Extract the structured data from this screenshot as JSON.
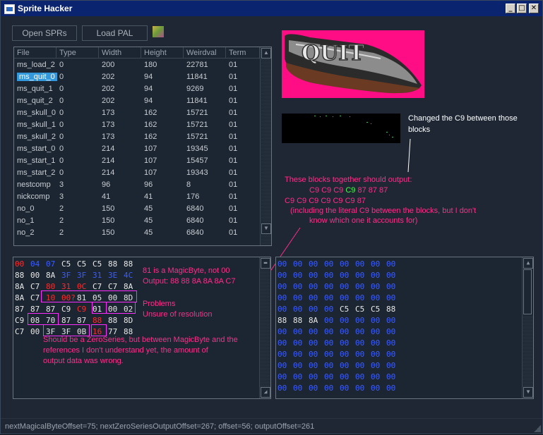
{
  "window": {
    "title": "Sprite Hacker",
    "min_glyph": "_",
    "max_glyph": "□",
    "close_glyph": "✕"
  },
  "toolbar": {
    "open_label": "Open SPRs",
    "load_label": "Load PAL",
    "icon": "palette-icon"
  },
  "list": {
    "columns": [
      "File",
      "Type",
      "Width",
      "Height",
      "Weirdval",
      "Term"
    ],
    "rows": [
      [
        "ms_load_2",
        "0",
        "200",
        "180",
        "22781",
        "01"
      ],
      [
        "ms_quit_0",
        "0",
        "202",
        "94",
        "11841",
        "01"
      ],
      [
        "ms_quit_1",
        "0",
        "202",
        "94",
        "9269",
        "01"
      ],
      [
        "ms_quit_2",
        "0",
        "202",
        "94",
        "11841",
        "01"
      ],
      [
        "ms_skull_0",
        "0",
        "173",
        "162",
        "15721",
        "01"
      ],
      [
        "ms_skull_1",
        "0",
        "173",
        "162",
        "15721",
        "01"
      ],
      [
        "ms_skull_2",
        "0",
        "173",
        "162",
        "15721",
        "01"
      ],
      [
        "ms_start_0",
        "0",
        "214",
        "107",
        "19345",
        "01"
      ],
      [
        "ms_start_1",
        "0",
        "214",
        "107",
        "15457",
        "01"
      ],
      [
        "ms_start_2",
        "0",
        "214",
        "107",
        "19343",
        "01"
      ],
      [
        "nestcomp",
        "3",
        "96",
        "96",
        "8",
        "01"
      ],
      [
        "nickcomp",
        "3",
        "41",
        "41",
        "176",
        "01"
      ],
      [
        "no_0",
        "2",
        "150",
        "45",
        "6840",
        "01"
      ],
      [
        "no_1",
        "2",
        "150",
        "45",
        "6840",
        "01"
      ],
      [
        "no_2",
        "2",
        "150",
        "45",
        "6840",
        "01"
      ]
    ],
    "selected_index": 1
  },
  "sprite": {
    "text": "QUIT"
  },
  "notes": {
    "changed": [
      "Changed the C9 between those",
      "blocks"
    ],
    "output_heading": "These blocks together should output:",
    "output_line1_a": "C9 C9 C9 ",
    "output_line1_b": "C9",
    "output_line1_c": " 87 87 87",
    "output_line2": "C9 C9 C9 C9 C9 C9 87",
    "output_line3": "(including the literal C9 between the blocks, but I don't",
    "output_line4": "know which one it accounts for)",
    "magic1": "81 is a MagicByte, not 00",
    "magic2": "Output: 88 88 8A 8A 8A C7",
    "problems": "Problems",
    "unsure": "Unsure of resolution",
    "zero1": "Should be a ZeroSeries, but between MagicByte and the",
    "zero2": "references I don't understand yet, the amount of",
    "zero3": "output data was wrong."
  },
  "hex_left": [
    [
      [
        "00",
        "r"
      ],
      [
        "04",
        "b"
      ],
      [
        "07",
        "b"
      ],
      [
        "C5",
        ""
      ],
      [
        "C5",
        ""
      ],
      [
        "C5",
        ""
      ],
      [
        "88",
        ""
      ],
      [
        "88",
        ""
      ]
    ],
    [
      [
        "88",
        ""
      ],
      [
        "00",
        ""
      ],
      [
        "8A",
        ""
      ],
      [
        "3F",
        "b"
      ],
      [
        "3F",
        "b"
      ],
      [
        "31",
        "b"
      ],
      [
        "3E",
        "b"
      ],
      [
        "4C",
        "b"
      ]
    ],
    [
      [
        "8A",
        ""
      ],
      [
        "C7",
        ""
      ],
      [
        "80",
        "r"
      ],
      [
        "31",
        "r"
      ],
      [
        "0C",
        "r"
      ],
      [
        "C7",
        ""
      ],
      [
        "C7",
        ""
      ],
      [
        "8A",
        ""
      ]
    ],
    [
      [
        "8A",
        ""
      ],
      [
        "C7",
        ""
      ],
      [
        "10",
        "r"
      ],
      [
        "00?",
        "r"
      ],
      [
        "81",
        ""
      ],
      [
        "05",
        ""
      ],
      [
        "00",
        ""
      ],
      [
        "8D",
        ""
      ]
    ],
    [
      [
        "87",
        ""
      ],
      [
        "87",
        ""
      ],
      [
        "87",
        ""
      ],
      [
        "C9",
        ""
      ],
      [
        "C9",
        "r"
      ],
      [
        "01",
        ""
      ],
      [
        "00",
        ""
      ],
      [
        "02",
        ""
      ]
    ],
    [
      [
        "C9",
        ""
      ],
      [
        "08",
        ""
      ],
      [
        "70",
        ""
      ],
      [
        "87",
        ""
      ],
      [
        "87",
        ""
      ],
      [
        "88",
        "r"
      ],
      [
        "88",
        ""
      ],
      [
        "8D",
        ""
      ]
    ],
    [
      [
        "C7",
        ""
      ],
      [
        "00",
        ""
      ],
      [
        "3F",
        ""
      ],
      [
        "3F",
        ""
      ],
      [
        "0B",
        ""
      ],
      [
        "16",
        "r"
      ],
      [
        "77",
        ""
      ],
      [
        "88",
        ""
      ]
    ]
  ],
  "hex_right": [
    [
      "00",
      "00",
      "00",
      "00",
      "00",
      "00",
      "00",
      "00"
    ],
    [
      "00",
      "00",
      "00",
      "00",
      "00",
      "00",
      "00",
      "00"
    ],
    [
      "00",
      "00",
      "00",
      "00",
      "00",
      "00",
      "00",
      "00"
    ],
    [
      "00",
      "00",
      "00",
      "00",
      "00",
      "00",
      "00",
      "00"
    ],
    [
      "00",
      "00",
      "00",
      "00",
      "C5",
      "C5",
      "C5",
      "88"
    ],
    [
      "88",
      "88",
      "8A",
      "00",
      "00",
      "00",
      "00",
      "00"
    ],
    [
      "00",
      "00",
      "00",
      "00",
      "00",
      "00",
      "00",
      "00"
    ],
    [
      "00",
      "00",
      "00",
      "00",
      "00",
      "00",
      "00",
      "00"
    ],
    [
      "00",
      "00",
      "00",
      "00",
      "00",
      "00",
      "00",
      "00"
    ],
    [
      "00",
      "00",
      "00",
      "00",
      "00",
      "00",
      "00",
      "00"
    ],
    [
      "00",
      "00",
      "00",
      "00",
      "00",
      "00",
      "00",
      "00"
    ],
    [
      "00",
      "00",
      "00",
      "00",
      "00",
      "00",
      "00",
      "00"
    ]
  ],
  "status": "nextMagicalByteOffset=75; nextZeroSeriesOutputOffset=267; offset=56; outputOffset=261"
}
